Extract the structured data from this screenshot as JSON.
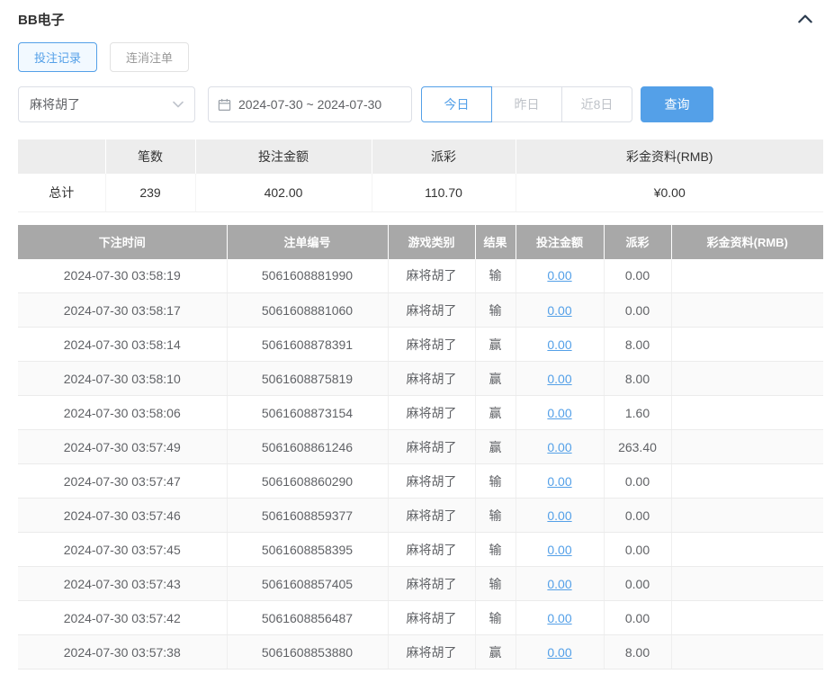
{
  "header": {
    "title": "BB电子"
  },
  "tabs": [
    {
      "label": "投注记录",
      "active": true
    },
    {
      "label": "连消注单",
      "active": false
    }
  ],
  "filters": {
    "game_select": {
      "value": "麻将胡了"
    },
    "date_range": {
      "value": "2024-07-30 ~ 2024-07-30"
    },
    "quick_ranges": [
      {
        "label": "今日",
        "active": true
      },
      {
        "label": "昨日",
        "active": false
      },
      {
        "label": "近8日",
        "active": false
      }
    ],
    "search_label": "查询"
  },
  "summary": {
    "headers": [
      "",
      "笔数",
      "投注金额",
      "派彩",
      "彩金资料(RMB)"
    ],
    "row": {
      "label": "总计",
      "count": "239",
      "bet_amount": "402.00",
      "payout": "110.70",
      "bonus": "¥0.00"
    }
  },
  "table": {
    "headers": [
      "下注时间",
      "注单编号",
      "游戏类别",
      "结果",
      "投注金额",
      "派彩",
      "彩金资料(RMB)"
    ],
    "rows": [
      {
        "time": "2024-07-30 03:58:19",
        "order_id": "5061608881990",
        "game": "麻将胡了",
        "result": "输",
        "bet": "0.00",
        "payout": "0.00",
        "bonus": ""
      },
      {
        "time": "2024-07-30 03:58:17",
        "order_id": "5061608881060",
        "game": "麻将胡了",
        "result": "输",
        "bet": "0.00",
        "payout": "0.00",
        "bonus": ""
      },
      {
        "time": "2024-07-30 03:58:14",
        "order_id": "5061608878391",
        "game": "麻将胡了",
        "result": "赢",
        "bet": "0.00",
        "payout": "8.00",
        "bonus": ""
      },
      {
        "time": "2024-07-30 03:58:10",
        "order_id": "5061608875819",
        "game": "麻将胡了",
        "result": "赢",
        "bet": "0.00",
        "payout": "8.00",
        "bonus": ""
      },
      {
        "time": "2024-07-30 03:58:06",
        "order_id": "5061608873154",
        "game": "麻将胡了",
        "result": "赢",
        "bet": "0.00",
        "payout": "1.60",
        "bonus": ""
      },
      {
        "time": "2024-07-30 03:57:49",
        "order_id": "5061608861246",
        "game": "麻将胡了",
        "result": "赢",
        "bet": "0.00",
        "payout": "263.40",
        "bonus": ""
      },
      {
        "time": "2024-07-30 03:57:47",
        "order_id": "5061608860290",
        "game": "麻将胡了",
        "result": "输",
        "bet": "0.00",
        "payout": "0.00",
        "bonus": ""
      },
      {
        "time": "2024-07-30 03:57:46",
        "order_id": "5061608859377",
        "game": "麻将胡了",
        "result": "输",
        "bet": "0.00",
        "payout": "0.00",
        "bonus": ""
      },
      {
        "time": "2024-07-30 03:57:45",
        "order_id": "5061608858395",
        "game": "麻将胡了",
        "result": "输",
        "bet": "0.00",
        "payout": "0.00",
        "bonus": ""
      },
      {
        "time": "2024-07-30 03:57:43",
        "order_id": "5061608857405",
        "game": "麻将胡了",
        "result": "输",
        "bet": "0.00",
        "payout": "0.00",
        "bonus": ""
      },
      {
        "time": "2024-07-30 03:57:42",
        "order_id": "5061608856487",
        "game": "麻将胡了",
        "result": "输",
        "bet": "0.00",
        "payout": "0.00",
        "bonus": ""
      },
      {
        "time": "2024-07-30 03:57:38",
        "order_id": "5061608853880",
        "game": "麻将胡了",
        "result": "赢",
        "bet": "0.00",
        "payout": "8.00",
        "bonus": ""
      }
    ]
  },
  "colors": {
    "accent": "#54a0e8",
    "table_header_bg": "#a8a8a8",
    "summary_header_bg": "#ededed",
    "link": "#54a0e8"
  }
}
